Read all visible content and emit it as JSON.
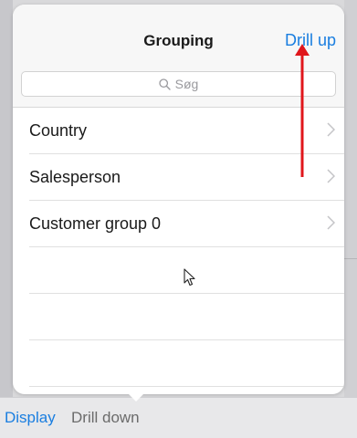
{
  "popover": {
    "title": "Grouping",
    "drill_up_label": "Drill up",
    "search": {
      "placeholder": "Søg"
    },
    "items": [
      {
        "label": "Country"
      },
      {
        "label": "Salesperson"
      },
      {
        "label": "Customer group 0"
      }
    ],
    "empty_rows": 3
  },
  "bottom_bar": {
    "display_label": "Display",
    "drill_down_label": "Drill down"
  },
  "colors": {
    "accent": "#1a7ee0",
    "annotation": "#e0161b",
    "header_bg": "#f7f7f7",
    "backdrop": "#d9d9db"
  },
  "icons": {
    "search": "search-icon",
    "chevron": "chevron-right-icon",
    "cursor": "mouse-pointer-icon",
    "annotation": "red-arrow-icon"
  }
}
